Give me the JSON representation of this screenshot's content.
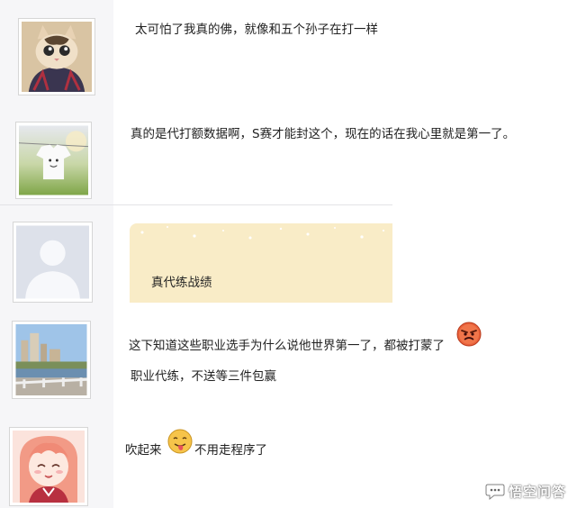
{
  "posts": [
    {
      "avatar_icon": "cat-photo-icon",
      "lines": [
        "太可怕了我真的佛，就像和五个孙子在打一样"
      ]
    },
    {
      "avatar_icon": "tshirt-photo-icon",
      "lines": [
        "真的是代打额数据啊，S赛才能封这个，现在的话在我心里就是第一了。"
      ]
    },
    {
      "avatar_icon": "default-avatar-icon",
      "bubble_text": "真代练战绩"
    },
    {
      "avatar_icon": "city-photo-icon",
      "lines": [
        "这下知道这些职业选手为什么说他世界第一了，都被打蒙了",
        "职业代练，不送等三件包赢"
      ],
      "emoji": "angry-face-icon"
    },
    {
      "avatar_icon": "anime-girl-icon",
      "text_before": "吹起来",
      "text_after": "不用走程序了",
      "emoji": "tongue-face-icon"
    }
  ],
  "watermark": {
    "icon": "chat-bubble-icon",
    "text": "悟空问答"
  },
  "colors": {
    "avatar_panel": "#f6f6f8",
    "bubble": "#f9ecc7",
    "divider": "#e3e3e6"
  }
}
